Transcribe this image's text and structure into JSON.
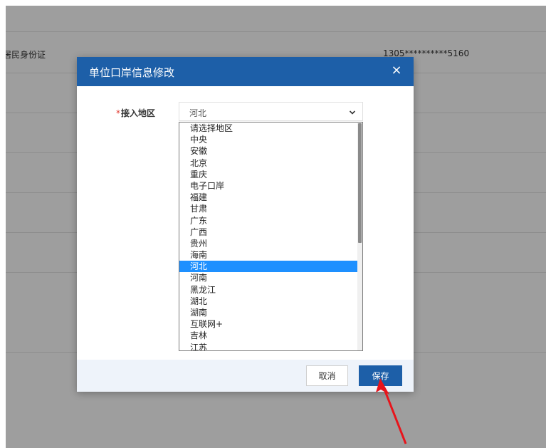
{
  "background": {
    "row1_left_text": "居民身份证",
    "row1_right_text": "1305**********5160"
  },
  "modal": {
    "title": "单位口岸信息修改",
    "close_glyph": "×"
  },
  "form": {
    "region_required_mark": "*",
    "region_label": "接入地区",
    "region_selected": "河北"
  },
  "dropdown": {
    "options": [
      "请选择地区",
      "中央",
      "安徽",
      "北京",
      "重庆",
      "电子口岸",
      "福建",
      "甘肃",
      "广东",
      "广西",
      "贵州",
      "海南",
      "河北",
      "河南",
      "黑龙江",
      "湖北",
      "湖南",
      "互联网+",
      "吉林",
      "江苏"
    ],
    "selected_index": 12
  },
  "footer": {
    "cancel_label": "取消",
    "save_label": "保存"
  },
  "colors": {
    "header": "#1d5fa8",
    "selected_option": "#1e90ff",
    "annotation_arrow": "#e8141b"
  },
  "icons": {
    "close": "close-icon",
    "chevron": "chevron-down-icon",
    "arrow": "annotation-arrow"
  }
}
